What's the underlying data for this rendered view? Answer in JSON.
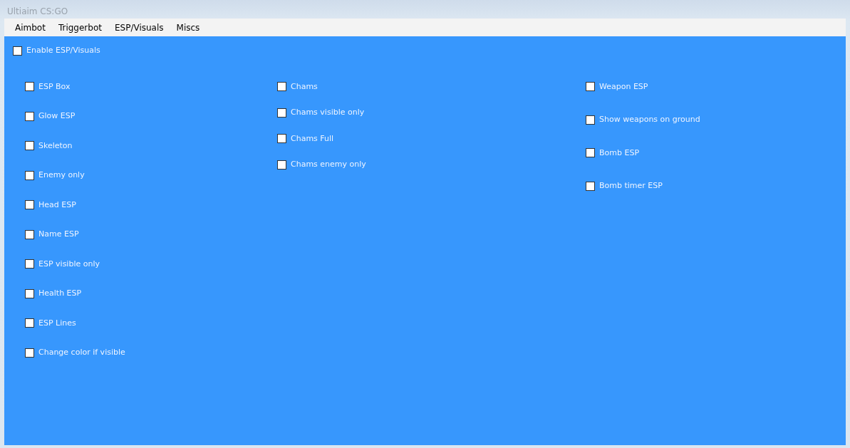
{
  "window": {
    "title": "Ultiaim CS:GO"
  },
  "menu": [
    "Aimbot",
    "Triggerbot",
    "ESP/Visuals",
    "Miscs"
  ],
  "master": {
    "label": "Enable ESP/Visuals",
    "checked": false
  },
  "columns": [
    [
      {
        "label": "ESP Box",
        "checked": false
      },
      {
        "label": "Glow ESP",
        "checked": false
      },
      {
        "label": "Skeleton",
        "checked": false
      },
      {
        "label": "Enemy only",
        "checked": false
      },
      {
        "label": "Head ESP",
        "checked": false
      },
      {
        "label": "Name ESP",
        "checked": false
      },
      {
        "label": "ESP visible only",
        "checked": false
      },
      {
        "label": "Health ESP",
        "checked": false
      },
      {
        "label": "ESP Lines",
        "checked": false
      },
      {
        "label": "Change color if visible",
        "checked": false
      }
    ],
    [
      {
        "label": "Chams",
        "checked": false
      },
      {
        "label": "Chams visible only",
        "checked": false
      },
      {
        "label": "Chams Full",
        "checked": false
      },
      {
        "label": "Chams enemy only",
        "checked": false
      }
    ],
    [
      {
        "label": "Weapon ESP",
        "checked": false
      },
      {
        "label": "Show weapons on ground",
        "checked": false
      },
      {
        "label": "Bomb ESP",
        "checked": false
      },
      {
        "label": "Bomb timer ESP",
        "checked": false
      }
    ]
  ]
}
